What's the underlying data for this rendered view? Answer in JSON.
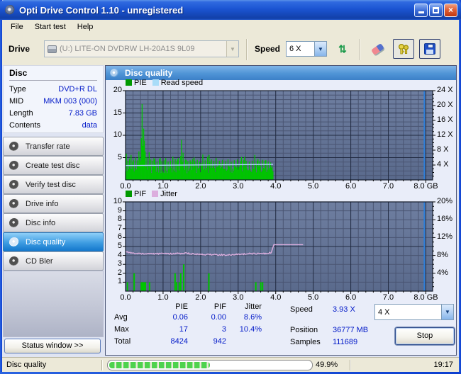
{
  "window": {
    "title": "Opti Drive Control 1.10 - unregistered"
  },
  "menu": {
    "items": [
      "File",
      "Start test",
      "Help"
    ]
  },
  "toolbar": {
    "drive_label": "Drive",
    "drive_value": "(U:) LITE-ON DVDRW LH-20A1S 9L09",
    "speed_label": "Speed",
    "speed_value": "6 X"
  },
  "disc_panel": {
    "title": "Disc",
    "rows": [
      {
        "label": "Type",
        "value": "DVD+R DL"
      },
      {
        "label": "MID",
        "value": "MKM 003 (000)"
      },
      {
        "label": "Length",
        "value": "7.83 GB"
      },
      {
        "label": "Contents",
        "value": "data"
      }
    ]
  },
  "sidebar": {
    "buttons": [
      {
        "label": "Transfer rate",
        "active": false
      },
      {
        "label": "Create test disc",
        "active": false
      },
      {
        "label": "Verify test disc",
        "active": false
      },
      {
        "label": "Drive info",
        "active": false
      },
      {
        "label": "Disc info",
        "active": false
      },
      {
        "label": "Disc quality",
        "active": true
      },
      {
        "label": "CD Bler",
        "active": false
      }
    ],
    "status_window_label": "Status window >>"
  },
  "main": {
    "header": "Disc quality"
  },
  "stats": {
    "col_headers": [
      "PIE",
      "PIF",
      "Jitter"
    ],
    "rows": [
      {
        "label": "Avg",
        "pie": "0.06",
        "pif": "0.00",
        "jitter": "8.6%"
      },
      {
        "label": "Max",
        "pie": "17",
        "pif": "3",
        "jitter": "10.4%"
      },
      {
        "label": "Total",
        "pie": "8424",
        "pif": "942",
        "jitter": ""
      }
    ],
    "speed_label": "Speed",
    "speed_value": "3.93 X",
    "position_label": "Position",
    "position_value": "36777 MB",
    "samples_label": "Samples",
    "samples_value": "111689",
    "speed_select_value": "4 X",
    "stop_label": "Stop"
  },
  "statusbar": {
    "mode": "Disc quality",
    "percent": "49.9%",
    "progress_fraction": 0.499,
    "time": "19:17"
  },
  "colors": {
    "pie_bar": "#00c400",
    "legend_green": "#009900",
    "read_speed": "#a9dcf8",
    "jitter": "#dcaede",
    "disc_end_marker": "#2e7ed8",
    "value_text": "#0018c8",
    "active_button": "#1478cc"
  },
  "chart_data": [
    {
      "type": "bar",
      "name": "pie-read-speed",
      "x_range": [
        0,
        8.18
      ],
      "x_major": 1,
      "x_minor": 0.2,
      "x_tick_values": [
        0,
        1,
        2,
        3,
        4,
        5,
        6,
        7,
        8
      ],
      "x_tick_labels": [
        "0.0",
        "1.0",
        "2.0",
        "3.0",
        "4.0",
        "5.0",
        "6.0",
        "7.0",
        "8.0 GB"
      ],
      "left_axis": {
        "max": 20,
        "ticks": [
          5,
          10,
          15,
          20
        ],
        "minor": 1,
        "major": 5
      },
      "right_axis": {
        "max": 24,
        "values": [
          4,
          8,
          12,
          16,
          20,
          24
        ],
        "labels": [
          "4 X",
          "8 X",
          "12 X",
          "16 X",
          "20 X",
          "24 X"
        ],
        "minor": 1
      },
      "legend": [
        {
          "label": "PIE",
          "color": "#009900"
        },
        {
          "label": "Read speed",
          "color": "#a9dcf8"
        }
      ],
      "bars": {
        "color": "#00c400",
        "from": 0,
        "to": 3.93,
        "step": 0.021,
        "base": 1.5,
        "amp": 1.8,
        "spikes": [
          [
            0.03,
            5.9
          ],
          [
            0.07,
            4.3
          ],
          [
            0.1,
            4.8
          ],
          [
            0.14,
            5.6
          ],
          [
            0.18,
            4.1
          ],
          [
            0.22,
            4.5
          ],
          [
            0.27,
            5.0
          ],
          [
            0.31,
            4.4
          ],
          [
            0.35,
            6.4
          ],
          [
            0.38,
            5.0
          ],
          [
            0.42,
            7.6
          ],
          [
            0.45,
            17
          ],
          [
            0.48,
            11.5
          ],
          [
            0.5,
            8.8
          ],
          [
            0.53,
            6.4
          ],
          [
            0.57,
            5.1
          ],
          [
            0.62,
            6.2
          ],
          [
            0.67,
            4.6
          ],
          [
            0.72,
            4.3
          ],
          [
            0.78,
            4.6
          ],
          [
            0.84,
            4.1
          ],
          [
            0.9,
            4.7
          ],
          [
            0.96,
            4.2
          ],
          [
            1.02,
            4.4
          ],
          [
            1.08,
            4.9
          ],
          [
            1.14,
            4.1
          ],
          [
            1.2,
            4.3
          ],
          [
            1.27,
            5.2
          ],
          [
            1.33,
            4.7
          ],
          [
            1.4,
            4.9
          ],
          [
            1.46,
            5.4
          ],
          [
            1.5,
            9.0
          ],
          [
            1.54,
            6.1
          ],
          [
            1.6,
            4.5
          ],
          [
            1.66,
            4.2
          ],
          [
            1.72,
            4.4
          ],
          [
            1.78,
            4.7
          ],
          [
            1.85,
            4.2
          ],
          [
            1.92,
            4.5
          ],
          [
            1.98,
            4.1
          ],
          [
            2.05,
            5.7
          ],
          [
            2.12,
            4.4
          ],
          [
            2.18,
            5.2
          ],
          [
            2.22,
            5.6
          ],
          [
            2.28,
            4.6
          ],
          [
            2.35,
            4.3
          ],
          [
            2.42,
            4.9
          ],
          [
            2.5,
            4.3
          ],
          [
            2.58,
            4.5
          ],
          [
            2.66,
            4.2
          ],
          [
            2.74,
            4.6
          ],
          [
            2.82,
            4.1
          ],
          [
            2.9,
            4.4
          ],
          [
            2.98,
            4.6
          ],
          [
            3.06,
            4.2
          ],
          [
            3.14,
            4.5
          ],
          [
            3.22,
            4.3
          ],
          [
            3.3,
            4.1
          ],
          [
            3.38,
            4.3
          ],
          [
            3.45,
            5.6
          ],
          [
            3.52,
            4.7
          ],
          [
            3.58,
            4.2
          ],
          [
            3.65,
            4.5
          ],
          [
            3.72,
            4.3
          ],
          [
            3.8,
            4.1
          ],
          [
            3.87,
            3.9
          ]
        ]
      },
      "line": {
        "color": "#a9dcf8",
        "points": [
          [
            0,
            3.22
          ],
          [
            3.93,
            3.48
          ]
        ]
      },
      "marker": {
        "x": 7.96,
        "color": "#2e7ed8"
      }
    },
    {
      "type": "bar",
      "name": "pif-jitter",
      "x_range": [
        0,
        8.18
      ],
      "x_major": 1,
      "x_minor": 0.2,
      "x_tick_values": [
        0,
        1,
        2,
        3,
        4,
        5,
        6,
        7,
        8
      ],
      "x_tick_labels": [
        "0.0",
        "1.0",
        "2.0",
        "3.0",
        "4.0",
        "5.0",
        "6.0",
        "7.0",
        "8.0 GB"
      ],
      "left_axis": {
        "max": 10,
        "ticks": [
          1,
          2,
          3,
          4,
          5,
          6,
          7,
          8,
          9,
          10
        ],
        "minor": 1,
        "major": 5
      },
      "right_axis": {
        "max": 20,
        "values": [
          4,
          8,
          12,
          16,
          20
        ],
        "labels": [
          "4%",
          "8%",
          "12%",
          "16%",
          "20%"
        ],
        "minor": 1
      },
      "legend": [
        {
          "label": "PIF",
          "color": "#009900"
        },
        {
          "label": "Jitter",
          "color": "#dcaede"
        }
      ],
      "bars": {
        "color": "#00c400",
        "spikes": [
          [
            0.05,
            1
          ],
          [
            0.23,
            2
          ],
          [
            0.42,
            1
          ],
          [
            0.45,
            1
          ],
          [
            0.47,
            1
          ],
          [
            0.5,
            1
          ],
          [
            0.53,
            1
          ],
          [
            0.64,
            1
          ],
          [
            1.32,
            2
          ],
          [
            1.36,
            1
          ],
          [
            1.43,
            1
          ],
          [
            1.47,
            2
          ],
          [
            1.55,
            3
          ],
          [
            2.22,
            2
          ],
          [
            3.47,
            1
          ],
          [
            3.6,
            1
          ],
          [
            3.65,
            1
          ]
        ]
      },
      "line": {
        "color": "#dcaede",
        "anchors": [
          [
            0,
            4.45
          ],
          [
            0.1,
            4.3
          ],
          [
            0.4,
            4.2
          ],
          [
            1.2,
            4.2
          ],
          [
            1.6,
            4.25
          ],
          [
            2.0,
            4.1
          ],
          [
            2.8,
            4.05
          ],
          [
            3.3,
            4.2
          ],
          [
            3.7,
            4.2
          ],
          [
            3.88,
            4.3
          ],
          [
            3.95,
            5.2
          ],
          [
            4.73,
            5.2
          ]
        ],
        "noise_until": 3.9,
        "noise_amp": 0.07
      },
      "marker": {
        "x": 7.96,
        "color": "#2e7ed8"
      }
    }
  ]
}
